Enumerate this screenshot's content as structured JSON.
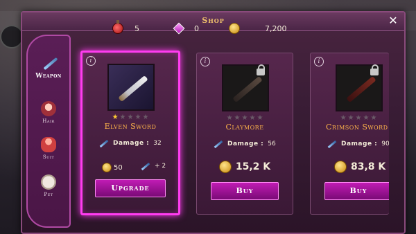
{
  "window": {
    "title": "Shop",
    "close_label": "✕"
  },
  "currencies": [
    {
      "icon": "potion-icon",
      "value": "5"
    },
    {
      "icon": "gem-icon",
      "value": "0"
    },
    {
      "icon": "coin-icon",
      "value": "7,200"
    }
  ],
  "sidebar": {
    "items": [
      {
        "icon": "weapon-icon",
        "label": "Weapon",
        "active": true
      },
      {
        "icon": "hair-icon",
        "label": "Hair",
        "active": false
      },
      {
        "icon": "suit-icon",
        "label": "Suit",
        "active": false
      },
      {
        "icon": "pet-icon",
        "label": "Pet",
        "active": false
      }
    ]
  },
  "cards": [
    {
      "name": "Elven Sword",
      "stars_filled": 1,
      "stars_total": 5,
      "locked": false,
      "damage_label": "Damage :",
      "damage_value": "32",
      "price": "50",
      "bonus": "+ 2",
      "button_label": "Upgrade",
      "info_label": "i"
    },
    {
      "name": "Claymore",
      "stars_filled": 0,
      "stars_total": 5,
      "locked": true,
      "damage_label": "Damage :",
      "damage_value": "56",
      "price": "15,2 K",
      "button_label": "Buy",
      "info_label": "i"
    },
    {
      "name": "Crimson Sword",
      "stars_filled": 0,
      "stars_total": 5,
      "locked": true,
      "damage_label": "Damage :",
      "damage_value": "90",
      "price": "83,8 K",
      "button_label": "Buy",
      "info_label": "i"
    }
  ],
  "colors": {
    "accent": "#ff3cf0",
    "item_name": "#ffb44a",
    "title": "#f1c36b",
    "button": "#c01cb4"
  }
}
